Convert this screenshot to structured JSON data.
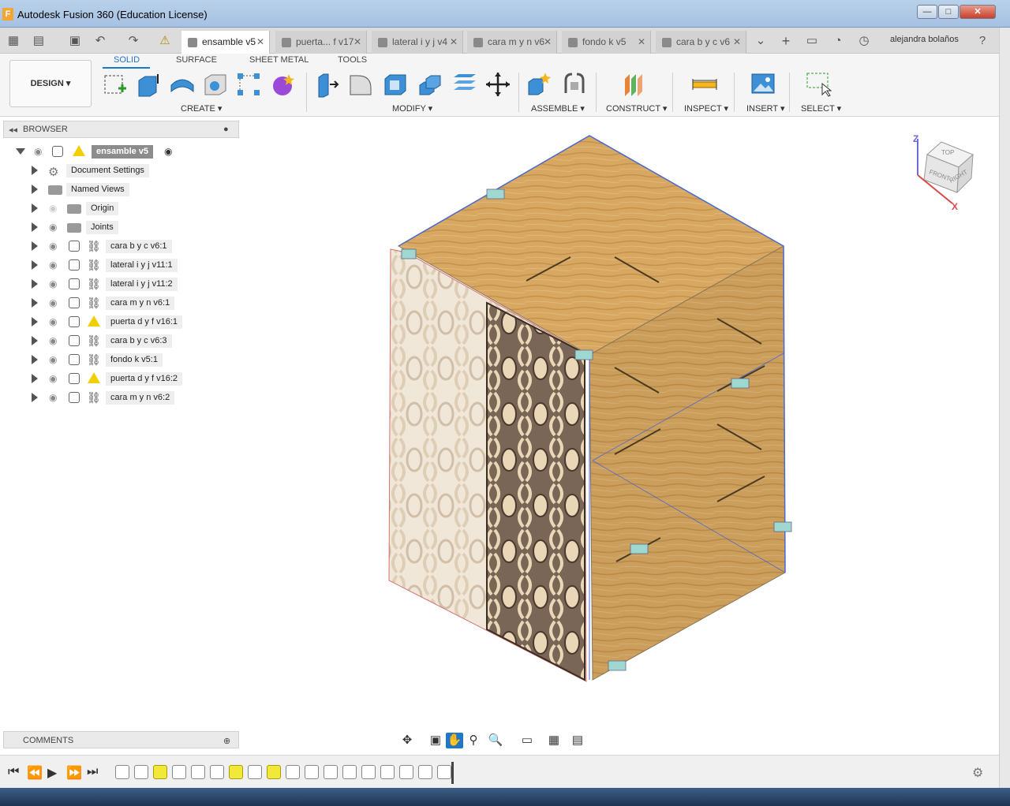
{
  "window": {
    "title": "Autodesk Fusion 360 (Education License)",
    "app_icon": "F"
  },
  "tabs": [
    {
      "label": "ensamble v5",
      "active": true
    },
    {
      "label": "puerta... f v17"
    },
    {
      "label": "lateral i y j v4"
    },
    {
      "label": "cara m y n v6"
    },
    {
      "label": "fondo k v5"
    },
    {
      "label": "cara b y c v6"
    }
  ],
  "user": {
    "name": "alejandra bolaños"
  },
  "toolbar": {
    "workspace": "DESIGN",
    "workspace_tabs": [
      "SOLID",
      "SURFACE",
      "SHEET METAL",
      "TOOLS"
    ],
    "groups": [
      "CREATE",
      "MODIFY",
      "ASSEMBLE",
      "CONSTRUCT",
      "INSPECT",
      "INSERT",
      "SELECT"
    ]
  },
  "browser": {
    "title": "BROWSER",
    "root": "ensamble v5",
    "items": [
      {
        "label": "Document Settings",
        "kind": "settings"
      },
      {
        "label": "Named Views",
        "kind": "folder"
      },
      {
        "label": "Origin",
        "kind": "folder"
      },
      {
        "label": "Joints",
        "kind": "folder"
      },
      {
        "label": "cara b y c v6:1",
        "kind": "link"
      },
      {
        "label": "lateral i y j v11:1",
        "kind": "link"
      },
      {
        "label": "lateral i y j v11:2",
        "kind": "link"
      },
      {
        "label": "cara m y n v6:1",
        "kind": "link"
      },
      {
        "label": "puerta d y f v16:1",
        "kind": "warn"
      },
      {
        "label": "cara b y c v6:3",
        "kind": "link"
      },
      {
        "label": "fondo k v5:1",
        "kind": "link"
      },
      {
        "label": "puerta d y f v16:2",
        "kind": "warn"
      },
      {
        "label": "cara m y n v6:2",
        "kind": "link"
      }
    ]
  },
  "comments": {
    "title": "COMMENTS"
  },
  "viewcube": {
    "top": "TOP",
    "front": "FRONT",
    "right": "RIGHT",
    "axis_z": "Z",
    "axis_x": "X"
  },
  "colors": {
    "accent": "#1e77c9",
    "wood": "#d6a45e",
    "panel_dark": "#6e5a48",
    "warning": "#f0d000"
  }
}
